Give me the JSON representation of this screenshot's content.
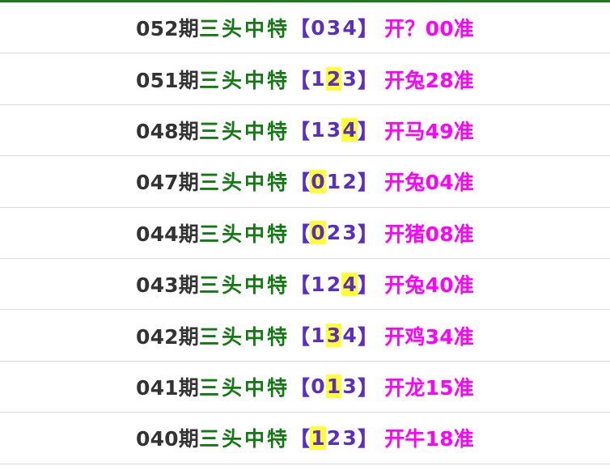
{
  "colors": {
    "top_border": "#1f7a1f",
    "period_text": "#333333",
    "label_text": "#117a11",
    "bracket_text": "#5a2fc0",
    "highlight": "#ffff33",
    "result_text": "#ff00ff"
  },
  "rows": [
    {
      "period": "052期",
      "label": "三头中特",
      "open": "【",
      "digits": [
        "0",
        "3",
        "4"
      ],
      "hit": [],
      "close": "】",
      "result": "开？00准"
    },
    {
      "period": "051期",
      "label": "三头中特",
      "open": "【",
      "digits": [
        "1",
        "2",
        "3"
      ],
      "hit": [
        1
      ],
      "close": "】",
      "result": "开兔28准"
    },
    {
      "period": "048期",
      "label": "三头中特",
      "open": "【",
      "digits": [
        "1",
        "3",
        "4"
      ],
      "hit": [
        2
      ],
      "close": "】",
      "result": "开马49准"
    },
    {
      "period": "047期",
      "label": "三头中特",
      "open": "【",
      "digits": [
        "0",
        "1",
        "2"
      ],
      "hit": [
        0
      ],
      "close": "】",
      "result": "开兔04准"
    },
    {
      "period": "044期",
      "label": "三头中特",
      "open": "【",
      "digits": [
        "0",
        "2",
        "3"
      ],
      "hit": [
        0
      ],
      "close": "】",
      "result": "开猪08准"
    },
    {
      "period": "043期",
      "label": "三头中特",
      "open": "【",
      "digits": [
        "1",
        "2",
        "4"
      ],
      "hit": [
        2
      ],
      "close": "】",
      "result": "开兔40准"
    },
    {
      "period": "042期",
      "label": "三头中特",
      "open": "【",
      "digits": [
        "1",
        "3",
        "4"
      ],
      "hit": [
        1
      ],
      "close": "】",
      "result": "开鸡34准"
    },
    {
      "period": "041期",
      "label": "三头中特",
      "open": "【",
      "digits": [
        "0",
        "1",
        "3"
      ],
      "hit": [
        1
      ],
      "close": "】",
      "result": "开龙15准"
    },
    {
      "period": "040期",
      "label": "三头中特",
      "open": "【",
      "digits": [
        "1",
        "2",
        "3"
      ],
      "hit": [
        0
      ],
      "close": "】",
      "result": "开牛18准"
    }
  ]
}
